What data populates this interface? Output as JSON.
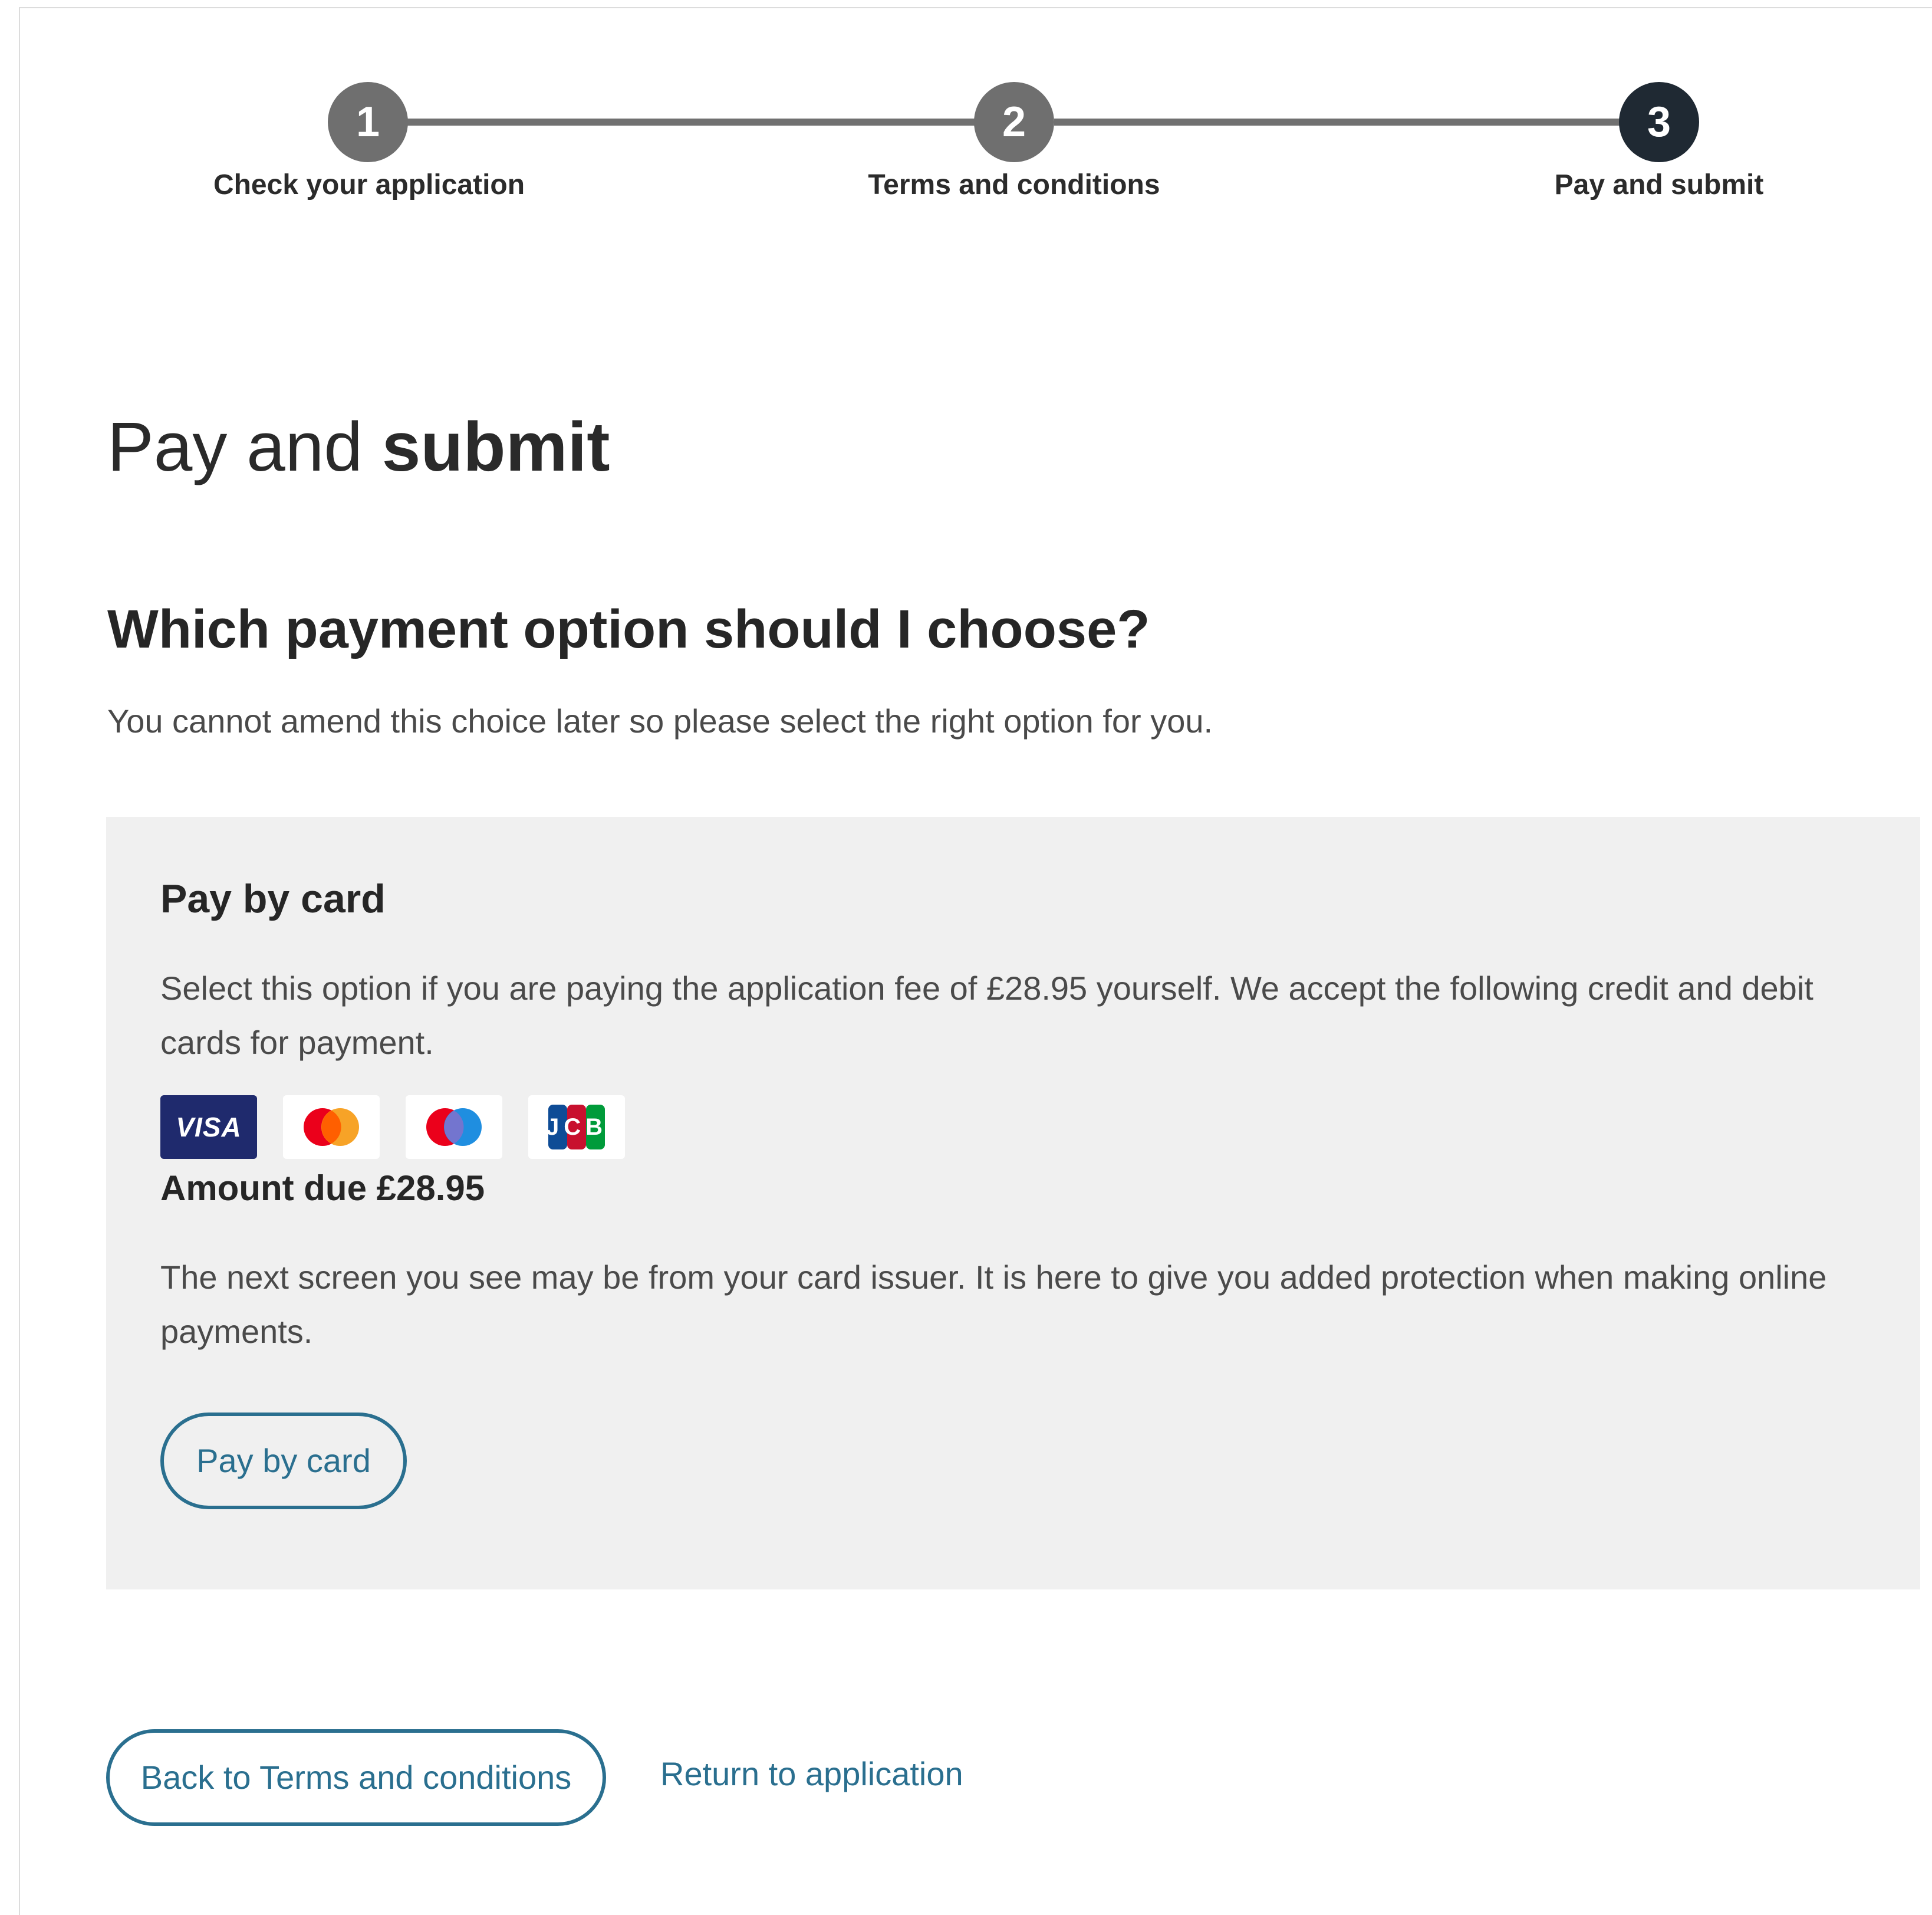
{
  "stepper": {
    "steps": [
      {
        "number": "1",
        "label": "Check your application",
        "state": "done"
      },
      {
        "number": "2",
        "label": "Terms and conditions",
        "state": "done"
      },
      {
        "number": "3",
        "label": "Pay and submit",
        "state": "current"
      }
    ]
  },
  "page": {
    "title_light": "Pay and",
    "title_bold": "submit"
  },
  "section": {
    "title": "Which payment option should I choose?",
    "intro": "You cannot amend this choice later so please select the right option for you."
  },
  "card_panel": {
    "title": "Pay by card",
    "description": "Select this option if you are paying the application fee of £28.95 yourself. We accept the following credit and debit cards for payment.",
    "card_logos": [
      {
        "name": "visa",
        "text": "VISA"
      },
      {
        "name": "mastercard"
      },
      {
        "name": "maestro"
      },
      {
        "name": "jcb",
        "text": "JCB"
      }
    ],
    "amount_due": "Amount due £28.95",
    "note": "The next screen you see may be from your card issuer. It is here to give you added protection when making online payments.",
    "button_label": "Pay by card"
  },
  "navigation": {
    "back_label": "Back to Terms and conditions",
    "return_label": "Return to application"
  },
  "colors": {
    "step_done": "#6f6f6f",
    "step_current": "#1f2933",
    "accent": "#2a6f8f",
    "panel_bg": "#f0f0f0",
    "visa_blue": "#1f2a6d",
    "mastercard_red": "#eb001b",
    "mastercard_orange": "#f79e1b",
    "maestro_blue": "#1f8ee0"
  }
}
